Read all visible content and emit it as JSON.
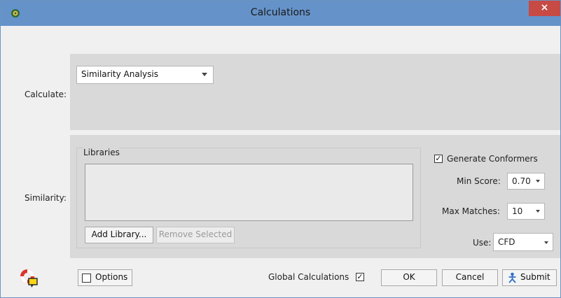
{
  "window": {
    "title": "Calculations",
    "close_glyph": "×"
  },
  "calculate": {
    "label": "Calculate:",
    "selected": "Similarity Analysis"
  },
  "similarity": {
    "label": "Similarity:",
    "libraries_title": "Libraries",
    "add_library": "Add Library...",
    "remove_selected": "Remove Selected",
    "generate_conformers": {
      "label": "Generate Conformers",
      "checked": true,
      "glyph": "✓"
    },
    "min_score": {
      "label": "Min Score:",
      "value": "0.70"
    },
    "max_matches": {
      "label": "Max Matches:",
      "value": "10"
    },
    "use": {
      "label": "Use:",
      "value": "CFD"
    }
  },
  "footer": {
    "options": "Options",
    "global_calculations": {
      "label": "Global Calculations",
      "checked": true,
      "glyph": "✓"
    },
    "ok": "OK",
    "cancel": "Cancel",
    "submit": "Submit"
  },
  "icons": {
    "app": "app-icon",
    "help": "lifebuoy-help-icon",
    "submit": "submit-icon"
  }
}
